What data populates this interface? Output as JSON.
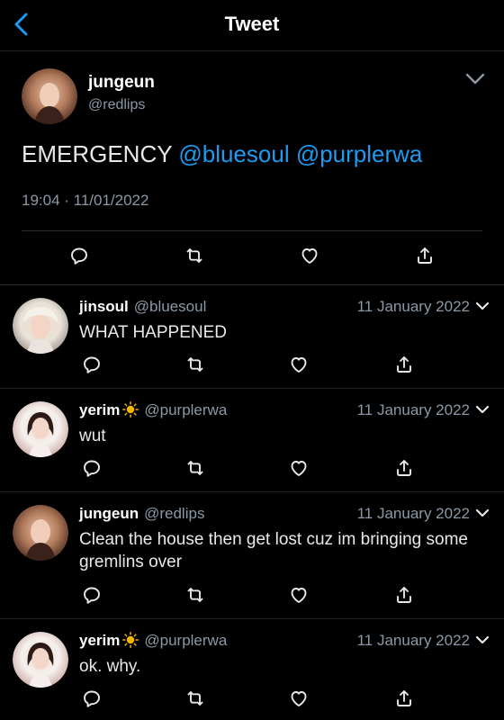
{
  "nav": {
    "title": "Tweet"
  },
  "main_tweet": {
    "name": "jungeun",
    "handle": "@redlips",
    "text_prefix": "EMERGENCY",
    "mentions": [
      "@bluesoul",
      "@purplerwa"
    ],
    "timestamp": "19:04 · 11/01/2022"
  },
  "replies": [
    {
      "name": "jinsoul",
      "has_sun_emoji": false,
      "handle": "@bluesoul",
      "date": "11 January 2022",
      "text": "WHAT HAPPENED"
    },
    {
      "name": "yerim",
      "has_sun_emoji": true,
      "handle": "@purplerwa",
      "date": "11 January 2022",
      "text": "wut"
    },
    {
      "name": "jungeun",
      "has_sun_emoji": false,
      "handle": "@redlips",
      "date": "11 January 2022",
      "text": "Clean the house then get lost cuz im bringing some gremlins over"
    },
    {
      "name": "yerim",
      "has_sun_emoji": true,
      "handle": "@purplerwa",
      "date": "11 January 2022",
      "text": "ok. why."
    }
  ],
  "icons": [
    "back-chevron-icon",
    "chevron-down-icon",
    "reply-icon",
    "retweet-icon",
    "like-icon",
    "share-icon",
    "sun-emoji-icon"
  ],
  "colors": {
    "background": "#000000",
    "mention": "#1d9bf0",
    "secondary_text": "#8b98a5",
    "back": "#1d9bf0"
  }
}
